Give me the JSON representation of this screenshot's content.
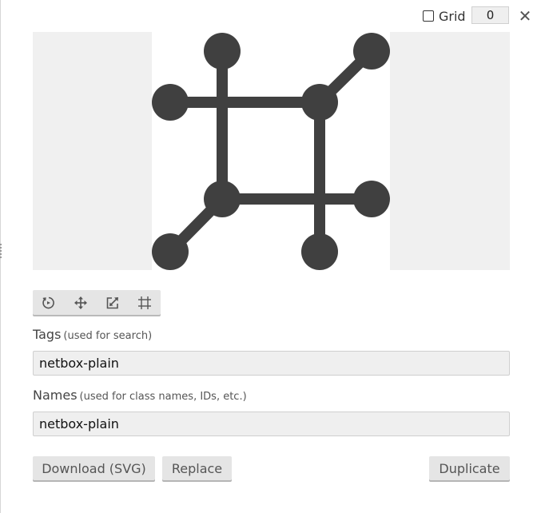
{
  "header": {
    "grid_label": "Grid",
    "grid_checked": false,
    "grid_size": "0",
    "close_label": "✕"
  },
  "icons": {
    "toolbar": [
      "rotate-icon",
      "move-icon",
      "scale-icon",
      "crop-icon"
    ],
    "close": "close-icon"
  },
  "tags": {
    "label": "Tags",
    "hint": "(used for search)",
    "value": "netbox-plain"
  },
  "names": {
    "label": "Names",
    "hint": "(used for class names, IDs, etc.)",
    "value": "netbox-plain"
  },
  "buttons": {
    "download": "Download (SVG)",
    "replace": "Replace",
    "duplicate": "Duplicate"
  },
  "colors": {
    "icon_fill": "#404040",
    "preview_background": "#f0f0f0",
    "canvas_background": "#ffffff"
  }
}
